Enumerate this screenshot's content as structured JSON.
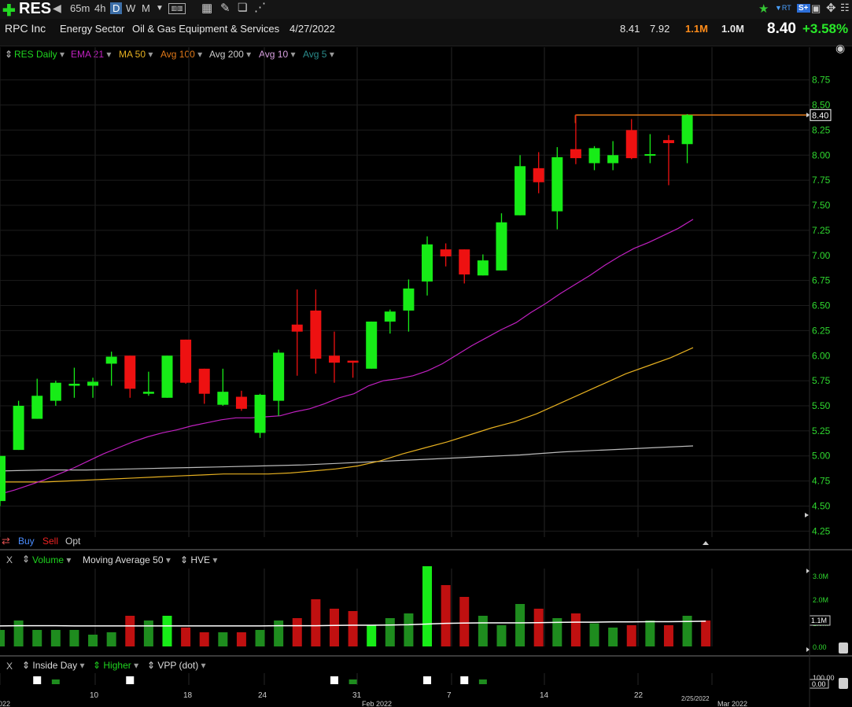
{
  "toolbar": {
    "ticker": "RES",
    "intervals": [
      "65m",
      "4h",
      "D",
      "W",
      "M"
    ],
    "active_interval": "D"
  },
  "info": {
    "company": "RPC Inc",
    "sector": "Energy Sector",
    "industry": "Oil & Gas Equipment & Services",
    "date": "4/27/2022",
    "high": "8.41",
    "low": "7.92",
    "volume": "1.1M",
    "avg_volume": "1.0M",
    "last": "8.40",
    "change": "+3.58%",
    "rt": "RT"
  },
  "legend": {
    "series": [
      {
        "label": "RES Daily",
        "color": "#1fd51f"
      },
      {
        "label": "EMA 21",
        "color": "#c020c0"
      },
      {
        "label": "MA 50",
        "color": "#e6b020"
      },
      {
        "label": "Avg 100",
        "color": "#e07818"
      },
      {
        "label": "Avg 200",
        "color": "#cccccc"
      },
      {
        "label": "Avg 10",
        "color": "#d8a0e0"
      },
      {
        "label": "Avg 5",
        "color": "#2a8c8c"
      }
    ]
  },
  "trade": {
    "buy": "Buy",
    "sell": "Sell",
    "opt": "Opt"
  },
  "volume_panel": {
    "close": "X",
    "volume_label": "Volume",
    "ma_label": "Moving Average 50",
    "hve_label": "HVE",
    "y_ticks": [
      "3.0M",
      "2.0M",
      "1.0M",
      "0.00"
    ],
    "current": "1.1M"
  },
  "ind_panel": {
    "close": "X",
    "inside_day": "Inside Day",
    "higher": "Higher",
    "vpp": "VPP (dot)",
    "y_ticks": [
      "100.00",
      "0.00"
    ]
  },
  "x_axis": {
    "labels": [
      "022",
      "10",
      "18",
      "24",
      "31",
      "Feb 2022",
      "7",
      "14",
      "22",
      "2/25/2022",
      "Mar 2022"
    ]
  },
  "colors": {
    "up": "#17ec17",
    "down": "#ee1111",
    "ema21": "#c020c0",
    "ma50": "#e6b020",
    "avg200": "#bbbbbb",
    "hline": "#e07818"
  },
  "chart_data": {
    "type": "candlestick",
    "ticker": "RES",
    "y_ticks": [
      8.75,
      8.5,
      8.25,
      8.0,
      7.75,
      7.5,
      7.25,
      7.0,
      6.75,
      6.5,
      6.25,
      6.0,
      5.75,
      5.5,
      5.25,
      5.0,
      4.75,
      4.5,
      4.25
    ],
    "ylim": [
      4.19,
      8.92
    ],
    "last_price_label": "8.40",
    "candles": [
      {
        "o": 4.55,
        "h": 5.0,
        "l": 4.5,
        "c": 5.0
      },
      {
        "o": 5.06,
        "h": 5.55,
        "l": 5.06,
        "c": 5.5
      },
      {
        "o": 5.37,
        "h": 5.77,
        "l": 5.37,
        "c": 5.6
      },
      {
        "o": 5.55,
        "h": 5.75,
        "l": 5.5,
        "c": 5.73
      },
      {
        "o": 5.7,
        "h": 5.88,
        "l": 5.58,
        "c": 5.72
      },
      {
        "o": 5.7,
        "h": 5.78,
        "l": 5.58,
        "c": 5.74
      },
      {
        "o": 5.92,
        "h": 6.04,
        "l": 5.7,
        "c": 5.99
      },
      {
        "o": 6.0,
        "h": 6.0,
        "l": 5.58,
        "c": 5.67
      },
      {
        "o": 5.62,
        "h": 5.84,
        "l": 5.6,
        "c": 5.64
      },
      {
        "o": 5.58,
        "h": 6.0,
        "l": 5.58,
        "c": 6.0
      },
      {
        "o": 6.16,
        "h": 6.16,
        "l": 5.72,
        "c": 5.73
      },
      {
        "o": 5.87,
        "h": 5.87,
        "l": 5.52,
        "c": 5.62
      },
      {
        "o": 5.51,
        "h": 5.87,
        "l": 5.5,
        "c": 5.64
      },
      {
        "o": 5.59,
        "h": 5.65,
        "l": 5.45,
        "c": 5.47
      },
      {
        "o": 5.23,
        "h": 5.62,
        "l": 5.18,
        "c": 5.61
      },
      {
        "o": 5.55,
        "h": 6.06,
        "l": 5.4,
        "c": 6.03
      },
      {
        "o": 6.31,
        "h": 6.66,
        "l": 5.8,
        "c": 6.24
      },
      {
        "o": 6.45,
        "h": 6.66,
        "l": 5.82,
        "c": 5.97
      },
      {
        "o": 6.0,
        "h": 6.24,
        "l": 5.73,
        "c": 5.93
      },
      {
        "o": 5.95,
        "h": 5.95,
        "l": 5.78,
        "c": 5.93
      },
      {
        "o": 5.87,
        "h": 6.34,
        "l": 5.87,
        "c": 6.34
      },
      {
        "o": 6.34,
        "h": 6.46,
        "l": 6.22,
        "c": 6.44
      },
      {
        "o": 6.45,
        "h": 6.76,
        "l": 6.24,
        "c": 6.67
      },
      {
        "o": 6.74,
        "h": 7.19,
        "l": 6.6,
        "c": 7.11
      },
      {
        "o": 7.06,
        "h": 7.12,
        "l": 6.89,
        "c": 6.99
      },
      {
        "o": 7.06,
        "h": 7.06,
        "l": 6.72,
        "c": 6.81
      },
      {
        "o": 6.8,
        "h": 7.01,
        "l": 6.8,
        "c": 6.95
      },
      {
        "o": 6.85,
        "h": 7.42,
        "l": 6.85,
        "c": 7.33
      },
      {
        "o": 7.4,
        "h": 8.0,
        "l": 7.4,
        "c": 7.89
      },
      {
        "o": 7.87,
        "h": 8.03,
        "l": 7.62,
        "c": 7.73
      },
      {
        "o": 7.44,
        "h": 8.08,
        "l": 7.26,
        "c": 7.98
      },
      {
        "o": 8.06,
        "h": 8.4,
        "l": 7.91,
        "c": 7.97
      },
      {
        "o": 7.92,
        "h": 8.09,
        "l": 7.85,
        "c": 8.07
      },
      {
        "o": 7.92,
        "h": 8.14,
        "l": 7.85,
        "c": 8.0
      },
      {
        "o": 8.25,
        "h": 8.36,
        "l": 7.96,
        "c": 7.97
      },
      {
        "o": 8.01,
        "h": 8.21,
        "l": 7.92,
        "c": 8.01
      },
      {
        "o": 8.15,
        "h": 8.2,
        "l": 7.7,
        "c": 8.12
      },
      {
        "o": 8.11,
        "h": 8.41,
        "l": 7.92,
        "c": 8.4
      }
    ],
    "ema21": [
      4.62,
      4.66,
      4.71,
      4.76,
      4.82,
      4.88,
      4.95,
      5.02,
      5.08,
      5.14,
      5.19,
      5.23,
      5.26,
      5.3,
      5.33,
      5.36,
      5.38,
      5.38,
      5.39,
      5.4,
      5.44,
      5.47,
      5.52,
      5.58,
      5.62,
      5.7,
      5.75,
      5.77,
      5.8,
      5.85,
      5.92,
      6.01,
      6.1,
      6.18,
      6.26,
      6.33,
      6.43,
      6.52,
      6.62,
      6.71,
      6.8,
      6.9,
      6.99,
      7.07,
      7.13,
      7.2,
      7.27,
      7.36
    ],
    "ma50": [
      4.74,
      4.74,
      4.74,
      4.75,
      4.76,
      4.77,
      4.78,
      4.79,
      4.8,
      4.81,
      4.82,
      4.82,
      4.82,
      4.83,
      4.85,
      4.87,
      4.9,
      4.95,
      5.02,
      5.08,
      5.14,
      5.21,
      5.28,
      5.34,
      5.42,
      5.52,
      5.62,
      5.72,
      5.82,
      5.9,
      5.98,
      6.08
    ],
    "avg200": [
      4.85,
      4.86,
      4.86,
      4.87,
      4.88,
      4.89,
      4.9,
      4.91,
      4.93,
      4.95,
      4.97,
      4.99,
      5.01,
      5.04,
      5.06,
      5.08,
      5.1
    ],
    "resistance": 8.4,
    "volume_ylim": [
      0,
      3.3
    ],
    "volume": [
      0.7,
      1.1,
      0.7,
      0.7,
      0.7,
      0.5,
      0.6,
      1.3,
      1.1,
      1.3,
      0.8,
      0.6,
      0.6,
      0.6,
      0.7,
      1.1,
      1.2,
      2.0,
      1.6,
      1.5,
      0.9,
      1.2,
      1.4,
      3.4,
      2.6,
      2.1,
      1.3,
      0.9,
      1.8,
      1.6,
      1.2,
      1.4,
      0.98,
      0.8,
      0.9,
      1.1,
      0.9,
      1.3,
      1.1
    ],
    "volume_ma": [
      0.87,
      0.88,
      0.88,
      0.88,
      0.87,
      0.87,
      0.87,
      0.87,
      0.87,
      0.87,
      0.87,
      0.87,
      0.87,
      0.87,
      0.87,
      0.88,
      0.88,
      0.88,
      0.89,
      0.9,
      0.9,
      0.91,
      0.92,
      0.95,
      0.98,
      0.99,
      1.0,
      1.0,
      1.0,
      1.01,
      1.02,
      1.03,
      1.03,
      1.04,
      1.04,
      1.05,
      1.05,
      1.06,
      1.07
    ],
    "inside_day_markers": [
      2,
      7,
      18,
      23,
      25
    ],
    "higher_markers": [
      3,
      19,
      26
    ]
  }
}
